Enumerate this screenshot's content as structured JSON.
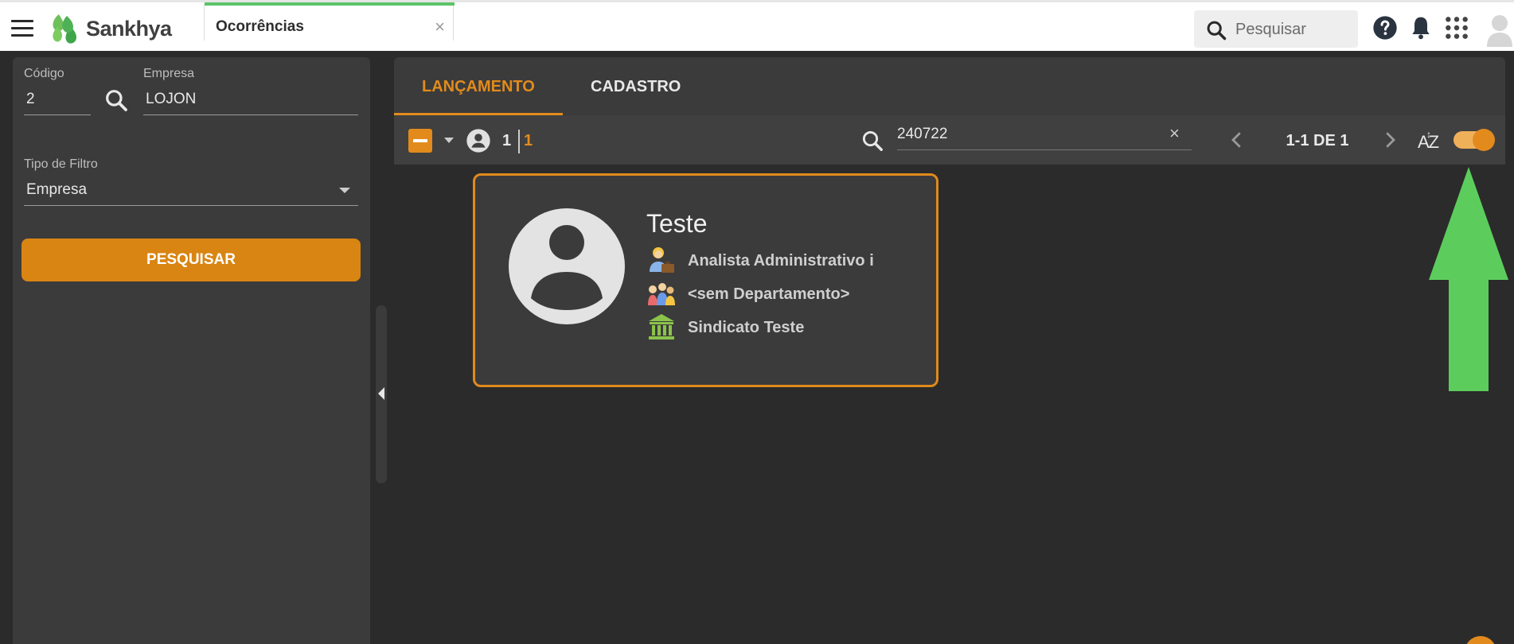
{
  "header": {
    "brand": "Sankhya",
    "tab_title": "Ocorrências",
    "tab_close": "×",
    "search_placeholder": "Pesquisar",
    "icons": [
      "hamburger-icon",
      "search-icon",
      "help-icon",
      "bell-icon",
      "apps-grid-icon",
      "user-avatar-icon"
    ],
    "accent_color": "#5cc46a"
  },
  "filters": {
    "codigo_label": "Código",
    "codigo_value": "2",
    "empresa_label": "Empresa",
    "empresa_value": "LOJON",
    "tipo_label": "Tipo de Filtro",
    "tipo_value": "Empresa",
    "search_button": "PESQUISAR",
    "button_color": "#d98513"
  },
  "tabs": [
    {
      "label": "LANÇAMENTO",
      "active": true
    },
    {
      "label": "CADASTRO",
      "active": false
    }
  ],
  "toolbar": {
    "selected_count": "1",
    "total_count": "1",
    "search_value": "240722",
    "clear": "×",
    "pager": "1-1 DE 1",
    "sort_label": "AZ",
    "toggle_on": true
  },
  "card": {
    "name": "Teste",
    "role": "Analista Administrativo i",
    "department": "<sem Departamento>",
    "union": "Sindicato Teste",
    "border_color": "#e08a1c"
  },
  "annotation": {
    "arrow_color": "#5ccd5c"
  }
}
